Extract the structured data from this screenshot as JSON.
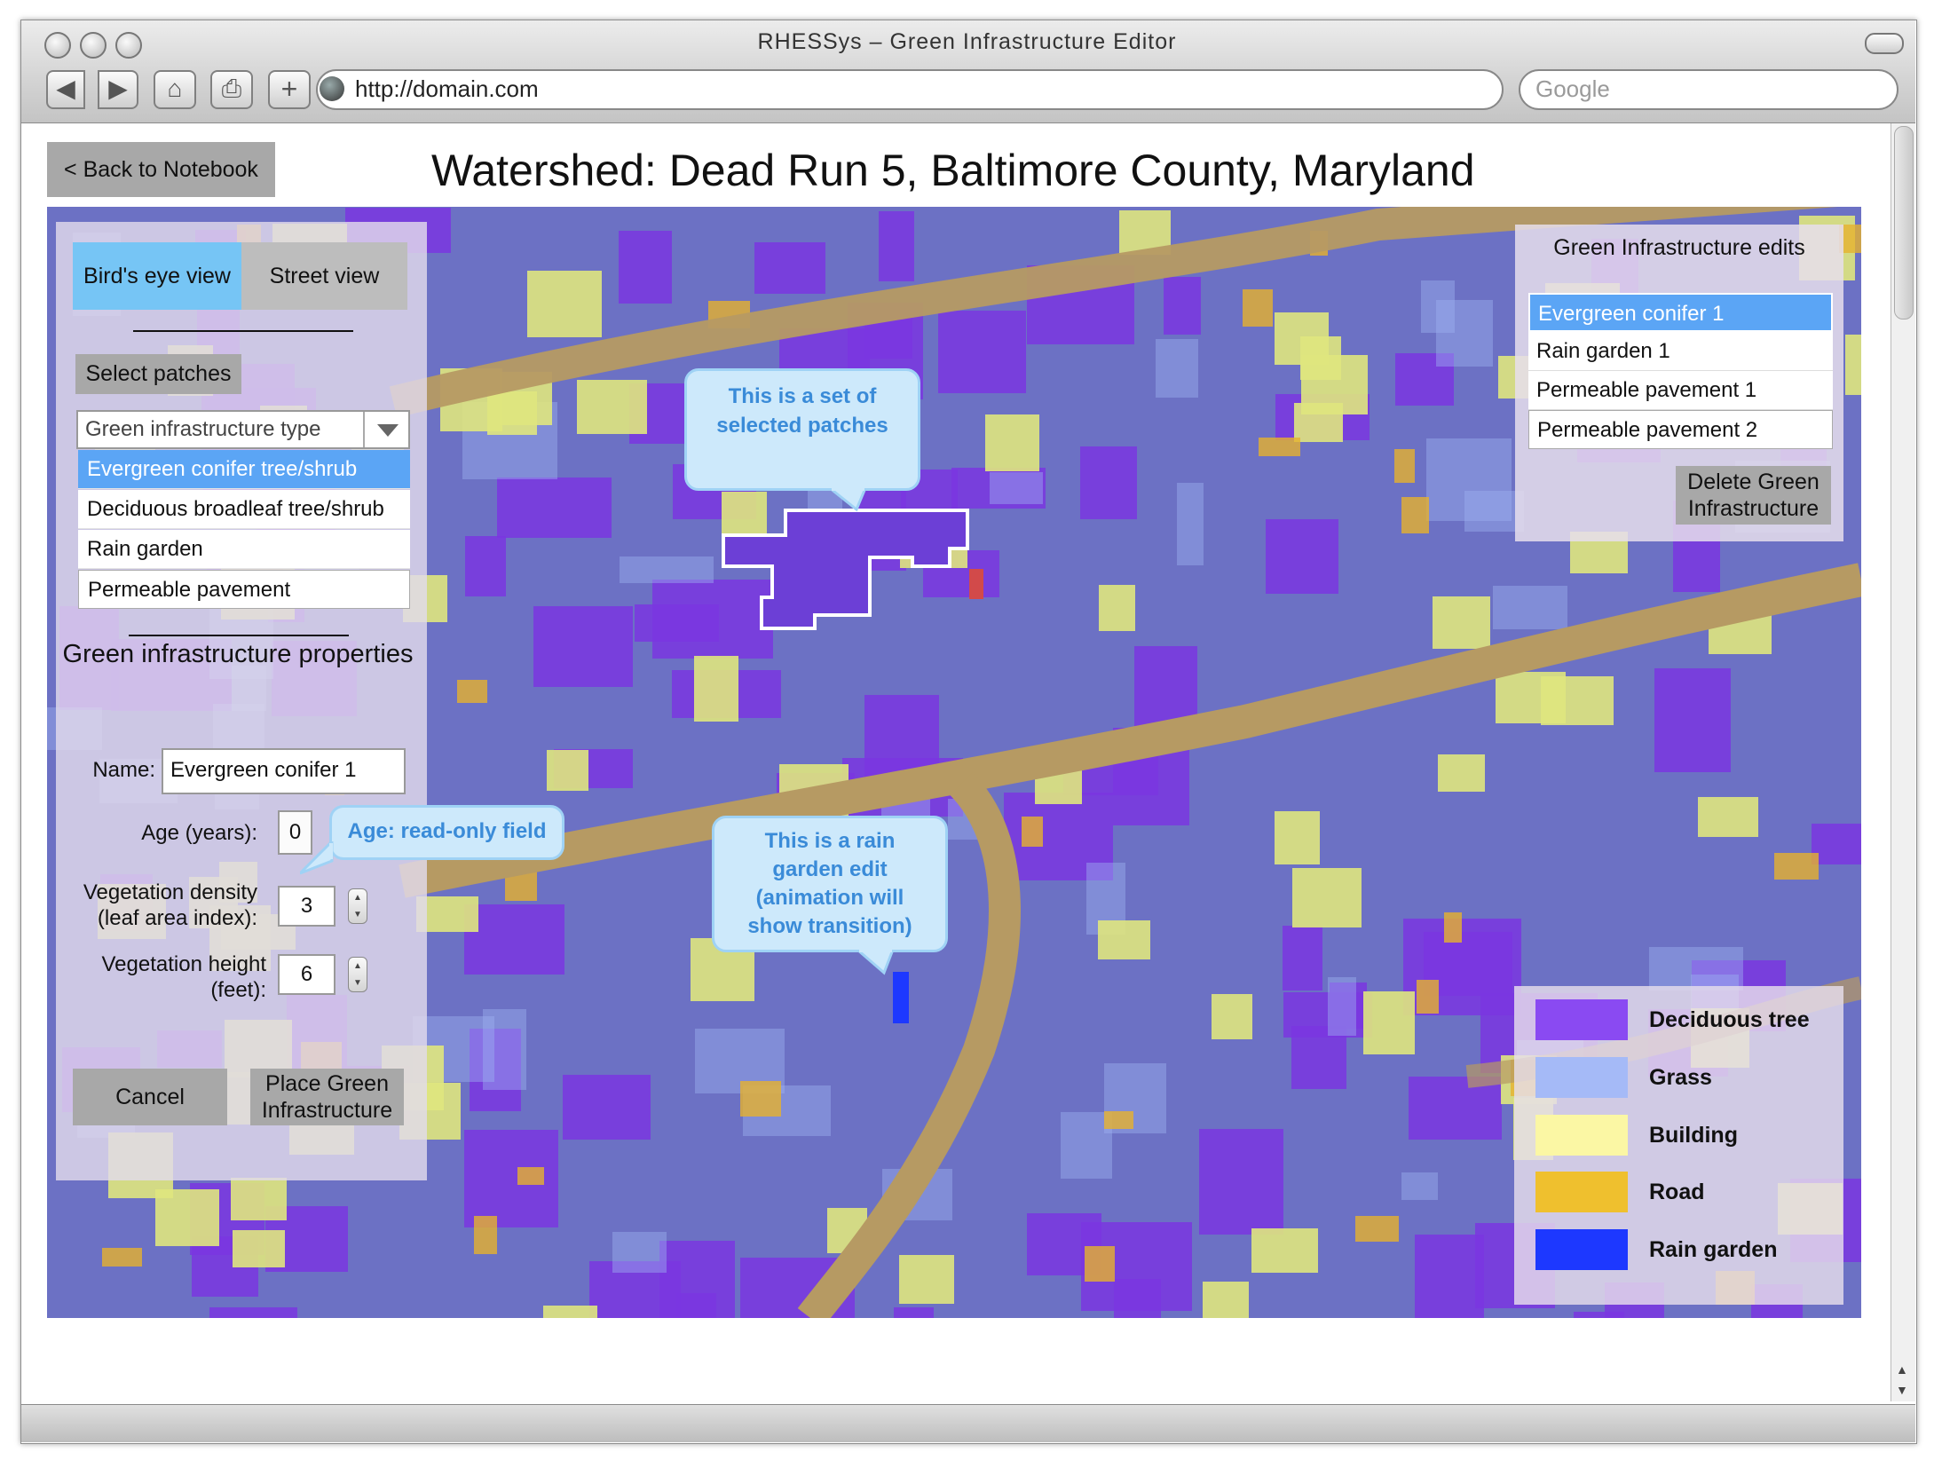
{
  "browser": {
    "window_title": "RHESSys – Green Infrastructure Editor",
    "url": "http://domain.com",
    "search_placeholder": "Google",
    "buttons": {
      "back": "◀",
      "forward": "▶",
      "home": "⌂",
      "print": "⎙",
      "add": "+"
    }
  },
  "header": {
    "back_label": "< Back to Notebook",
    "title": "Watershed: Dead Run 5, Baltimore County, Maryland"
  },
  "view_tabs": {
    "birds_eye": "Bird's eye view",
    "street": "Street view"
  },
  "select_patches_label": "Select patches",
  "gi_type": {
    "label": "Green infrastructure type",
    "options": [
      "Evergreen conifer tree/shrub",
      "Deciduous broadleaf tree/shrub",
      "Rain garden",
      "Permeable pavement"
    ]
  },
  "properties": {
    "title": "Green infrastructure properties",
    "name_label": "Name:",
    "name_value": "Evergreen conifer 1",
    "age_label": "Age (years):",
    "age_value": "0",
    "density_label": "Vegetation density (leaf area index):",
    "density_value": "3",
    "height_label": "Vegetation height (feet):",
    "height_value": "6"
  },
  "actions": {
    "cancel": "Cancel",
    "place": "Place Green Infrastructure"
  },
  "callouts": {
    "selected": "This is a set of selected patches",
    "age": "Age: read-only field",
    "rain_garden": "This is a rain garden edit (animation will show transition)"
  },
  "edits": {
    "title": "Green Infrastructure edits",
    "items": [
      "Evergreen conifer 1",
      "Rain garden 1",
      "Permeable pavement 1",
      "Permeable pavement 2"
    ],
    "delete_label": "Delete Green Infrastructure"
  },
  "legend": [
    {
      "label": "Deciduous tree",
      "color": "#8a4af2"
    },
    {
      "label": "Grass",
      "color": "#a5baf7"
    },
    {
      "label": "Building",
      "color": "#fbf7a4"
    },
    {
      "label": "Road",
      "color": "#efc02e"
    },
    {
      "label": "Rain garden",
      "color": "#1d38ff"
    }
  ],
  "colors": {
    "map_base": "#6f72c4",
    "road": "#b59a62",
    "selection_outline": "#ffffff",
    "tab_active": "#76c5f5",
    "list_selected": "#5ba5f5"
  }
}
